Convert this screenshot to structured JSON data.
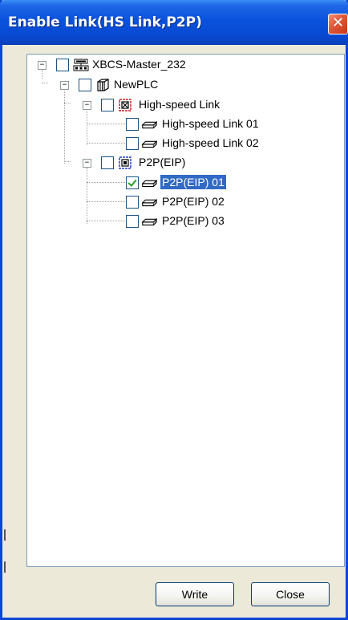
{
  "window": {
    "title": "Enable Link(HS Link,P2P)",
    "close_glyph": "✕"
  },
  "tree": {
    "root": {
      "label": "XBCS-Master_232",
      "expander": "−",
      "icon": "network-station-icon"
    },
    "plc": {
      "label": "NewPLC",
      "expander": "−",
      "icon": "plc-icon"
    },
    "hs_group": {
      "label": "High-speed Link",
      "expander": "−",
      "icon": "hs-link-group-icon",
      "color": "#d02020"
    },
    "hs_items": [
      {
        "label": "High-speed Link 01",
        "checked": false
      },
      {
        "label": "High-speed Link 02",
        "checked": false
      }
    ],
    "p2p_group": {
      "label": "P2P(EIP)",
      "expander": "−",
      "icon": "p2p-group-icon",
      "color": "#2040c0"
    },
    "p2p_items": [
      {
        "label": "P2P(EIP) 01",
        "checked": true,
        "selected": true
      },
      {
        "label": "P2P(EIP) 02",
        "checked": false
      },
      {
        "label": "P2P(EIP) 03",
        "checked": false
      }
    ]
  },
  "buttons": {
    "write": "Write",
    "close": "Close"
  },
  "colors": {
    "titlebar": "#0a52dc",
    "selection": "#316ac5",
    "close_button": "#e25a3c"
  }
}
